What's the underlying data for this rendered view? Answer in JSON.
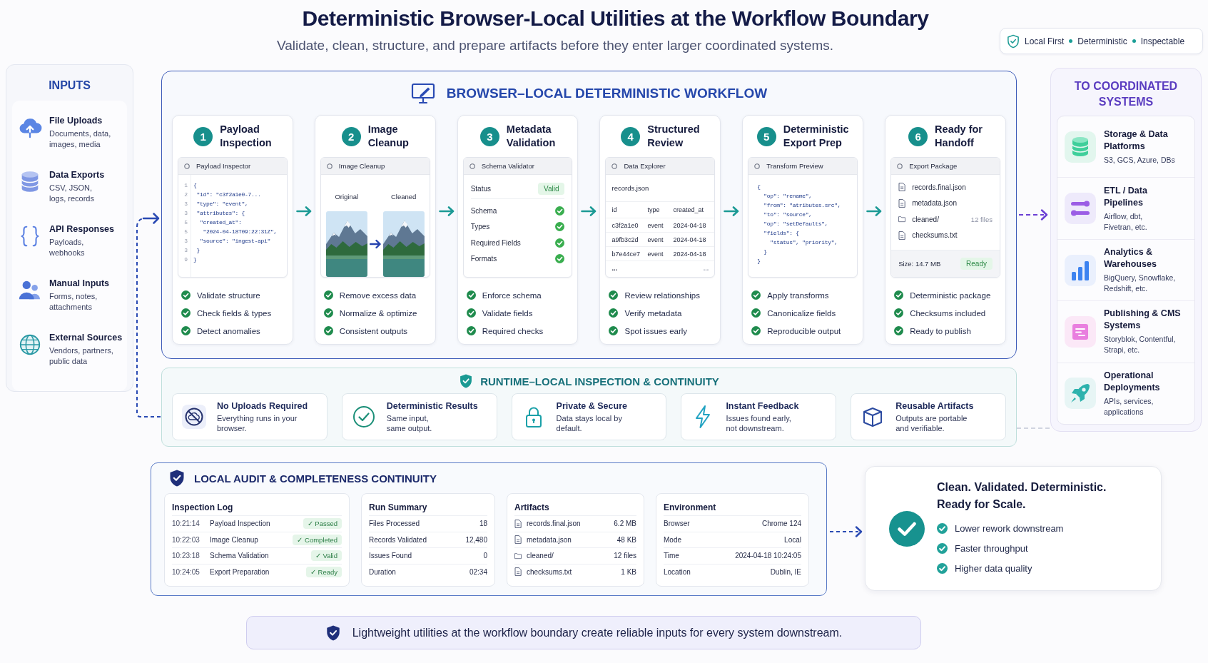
{
  "header": {
    "title": "Deterministic Browser-Local Utilities at the Workflow Boundary",
    "subtitle": "Validate, clean, structure, and prepare artifacts before they enter larger coordinated systems.",
    "badge": [
      "Local First",
      "Deterministic",
      "Inspectable"
    ]
  },
  "inputs": {
    "title": "INPUTS",
    "items": [
      {
        "kind": "upload",
        "title": "File Uploads",
        "description_lines": [
          "Documents, data,",
          "images, media"
        ]
      },
      {
        "kind": "export",
        "title": "Data Exports",
        "description_lines": [
          "CSV, JSON,",
          "logs, records"
        ]
      },
      {
        "kind": "api",
        "title": "API Responses",
        "description_lines": [
          "Payloads,",
          "webhooks"
        ]
      },
      {
        "kind": "manual",
        "title": "Manual Inputs",
        "description_lines": [
          "Forms, notes,",
          "attachments"
        ]
      },
      {
        "kind": "external",
        "title": "External Sources",
        "description_lines": [
          "Vendors, partners,",
          "public data"
        ]
      }
    ]
  },
  "workflow": {
    "title": "BROWSER–LOCAL DETERMINISTIC WORKFLOW",
    "steps": [
      {
        "number": "1",
        "title_lines": [
          "Payload",
          "Inspection"
        ],
        "window": {
          "kind": "code",
          "title": "Payload Inspector",
          "lines": [
            {
              "number": "1",
              "code": "{"
            },
            {
              "number": "2",
              "code": " \"id\": \"c3f2a1e0-7..."
            },
            {
              "number": "3",
              "code": " \"type\": \"event\","
            },
            {
              "number": "3",
              "code": " \"attributes\": {"
            },
            {
              "number": "5",
              "code": "  \"created_at\":"
            },
            {
              "number": "5",
              "code": "   \"2024-04-18T09:22:31Z\","
            },
            {
              "number": "3",
              "code": "  \"source\": \"ingest-api\""
            },
            {
              "number": "3",
              "code": " }"
            },
            {
              "number": "9",
              "code": "}"
            }
          ]
        },
        "checks": [
          "Validate structure",
          "Check fields & types",
          "Detect anomalies"
        ]
      },
      {
        "number": "2",
        "title_lines": [
          "Image",
          "Cleanup"
        ],
        "window": {
          "kind": "images",
          "title": "Image Cleanup",
          "images": [
            {
              "label": "Original"
            },
            {
              "label": "Cleaned"
            }
          ]
        },
        "checks": [
          "Remove excess data",
          "Normalize & optimize",
          "Consistent outputs"
        ]
      },
      {
        "number": "3",
        "title_lines": [
          "Metadata",
          "Validation"
        ],
        "window": {
          "kind": "validator",
          "title": "Schema Validator",
          "status_label": "Status",
          "status": "Valid",
          "rows": [
            {
              "label": "Schema",
              "passed": true
            },
            {
              "label": "Types",
              "passed": true
            },
            {
              "label": "Required Fields",
              "passed": true
            },
            {
              "label": "Formats",
              "passed": true
            }
          ]
        },
        "checks": [
          "Enforce schema",
          "Validate fields",
          "Required checks"
        ]
      },
      {
        "number": "4",
        "title_lines": [
          "Structured",
          "Review"
        ],
        "window": {
          "kind": "table",
          "title": "Data Explorer",
          "file": "records.json",
          "columns": [
            "id",
            "type",
            "created_at"
          ],
          "rows": [
            [
              "c3f2a1e0",
              "event",
              "2024-04-18"
            ],
            [
              "a9fb3c2d",
              "event",
              "2024-04-18"
            ],
            [
              "b7e44ce7",
              "event",
              "2024-04-18"
            ]
          ],
          "more": [
            "...",
            "..."
          ]
        },
        "checks": [
          "Review relationships",
          "Verify metadata",
          "Spot issues early"
        ]
      },
      {
        "number": "5",
        "title_lines": [
          "Deterministic",
          "Export Prep"
        ],
        "window": {
          "kind": "code",
          "title": "Transform Preview",
          "lines": [
            {
              "code": "{"
            },
            {
              "code": "  \"op\": \"rename\","
            },
            {
              "code": "  \"from\": \"atributes.src\","
            },
            {
              "code": "  \"to\": \"source\","
            },
            {
              "code": "  \"op\": \"setDefaults\","
            },
            {
              "code": "  \"fields\": {"
            },
            {
              "code": "    \"status\", \"priority\","
            },
            {
              "code": "  }"
            },
            {
              "code": "}"
            }
          ]
        },
        "checks": [
          "Apply transforms",
          "Canonicalize fields",
          "Reproducible output"
        ]
      },
      {
        "number": "6",
        "title_lines": [
          "Ready for",
          "Handoff"
        ],
        "window": {
          "kind": "files",
          "title": "Export Package",
          "files": [
            {
              "kind": "file",
              "name": "records.final.json"
            },
            {
              "kind": "file",
              "name": "metadata.json"
            },
            {
              "kind": "folder",
              "name": "cleaned/",
              "note": "12 files"
            },
            {
              "kind": "file",
              "name": "checksums.txt"
            }
          ],
          "size": "Size: 14.7 MB",
          "status": "Ready"
        },
        "checks": [
          "Deterministic package",
          "Checksums included",
          "Ready to publish"
        ]
      }
    ]
  },
  "runtime": {
    "title": "RUNTIME–LOCAL INSPECTION & CONTINUITY",
    "cards": [
      {
        "kind": "offline",
        "title": "No Uploads Required",
        "description_lines": [
          "Everything runs in your",
          "browser."
        ]
      },
      {
        "kind": "deterministic",
        "title": "Deterministic Results",
        "description_lines": [
          "Same input,",
          "same output."
        ]
      },
      {
        "kind": "private",
        "title": "Private & Secure",
        "description_lines": [
          "Data stays local by",
          "default."
        ]
      },
      {
        "kind": "instant",
        "title": "Instant Feedback",
        "description_lines": [
          "Issues found early,",
          "not downstream."
        ]
      },
      {
        "kind": "reusable",
        "title": "Reusable Artifacts",
        "description_lines": [
          "Outputs are portable",
          "and verifiable."
        ]
      }
    ]
  },
  "destinations": {
    "title_lines": [
      "TO COORDINATED",
      "SYSTEMS"
    ],
    "items": [
      {
        "kind": "storage",
        "title_lines": [
          "Storage & Data",
          "Platforms"
        ],
        "description_lines": [
          "S3, GCS, Azure, DBs"
        ]
      },
      {
        "kind": "etl",
        "title_lines": [
          "ETL / Data",
          "Pipelines"
        ],
        "description_lines": [
          "Airflow, dbt,",
          "Fivetran, etc."
        ]
      },
      {
        "kind": "analytics",
        "title_lines": [
          "Analytics &",
          "Warehouses"
        ],
        "description_lines": [
          "BigQuery, Snowflake,",
          "Redshift, etc."
        ]
      },
      {
        "kind": "publishing",
        "title_lines": [
          "Publishing & CMS",
          "Systems"
        ],
        "description_lines": [
          "Storyblok, Contentful,",
          "Strapi, etc."
        ]
      },
      {
        "kind": "operations",
        "title_lines": [
          "Operational",
          "Deployments"
        ],
        "description_lines": [
          "APIs, services,",
          "applications"
        ]
      }
    ]
  },
  "audit": {
    "title": "LOCAL AUDIT & COMPLETENESS CONTINUITY",
    "panels": [
      {
        "kind": "log",
        "title": "Inspection Log",
        "rows": [
          {
            "time": "10:21:14",
            "label": "Payload Inspection",
            "status": "✓ Passed"
          },
          {
            "time": "10:22:03",
            "label": "Image Cleanup",
            "status": "✓ Completed"
          },
          {
            "time": "10:23:18",
            "label": "Schema Validation",
            "status": "✓ Valid"
          },
          {
            "time": "10:24:05",
            "label": "Export Preparation",
            "status": "✓ Ready"
          }
        ]
      },
      {
        "kind": "summary",
        "title": "Run Summary",
        "rows": [
          {
            "label": "Files Processed",
            "value": "18"
          },
          {
            "label": "Records Validated",
            "value": "12,480"
          },
          {
            "label": "Issues Found",
            "value": "0"
          },
          {
            "label": "Duration",
            "value": "02:34"
          }
        ]
      },
      {
        "kind": "artifacts",
        "title": "Artifacts",
        "rows": [
          {
            "kind": "file",
            "label": "records.final.json",
            "value": "6.2 MB"
          },
          {
            "kind": "file",
            "label": "metadata.json",
            "value": "48 KB"
          },
          {
            "kind": "folder",
            "label": "cleaned/",
            "value": "12 files"
          },
          {
            "kind": "file",
            "label": "checksums.txt",
            "value": "1 KB"
          }
        ]
      },
      {
        "kind": "environment",
        "title": "Environment",
        "rows": [
          {
            "label": "Browser",
            "value": "Chrome 124"
          },
          {
            "label": "Mode",
            "value": "Local"
          },
          {
            "label": "Time",
            "value": "2024-04-18 10:24:05"
          },
          {
            "label": "Location",
            "value": "Dublin, IE"
          }
        ]
      }
    ]
  },
  "result": {
    "title_lines": [
      "Clean. Validated. Deterministic.",
      "Ready for Scale."
    ],
    "benefits": [
      "Lower rework downstream",
      "Faster throughput",
      "Higher data quality"
    ]
  },
  "footer": {
    "text": "Lightweight utilities at the workflow boundary create reliable inputs for every system downstream."
  }
}
